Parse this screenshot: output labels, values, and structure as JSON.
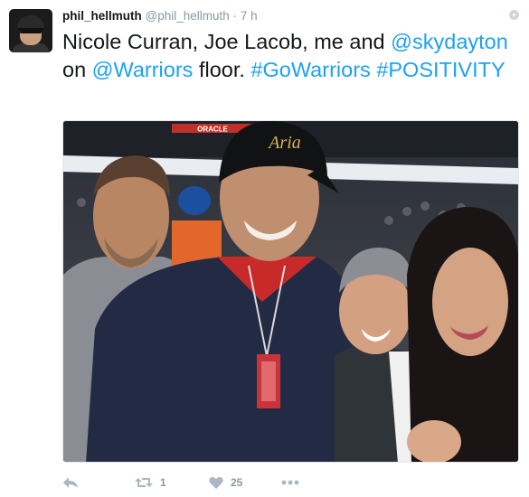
{
  "tweet": {
    "display_name": "phil_hellmuth",
    "handle": "@phil_hellmuth",
    "separator": "·",
    "time": "7 h",
    "text_parts": [
      {
        "text": "Nicole Curran, Joe Lacob, me and ",
        "link": false
      },
      {
        "text": "@skydayton",
        "link": true
      },
      {
        "text": " on ",
        "link": false
      },
      {
        "text": "@Warriors",
        "link": true
      },
      {
        "text": " floor. ",
        "link": false
      },
      {
        "text": "#GoWarriors",
        "link": true
      },
      {
        "text": " ",
        "link": false
      },
      {
        "text": "#POSITIVITY",
        "link": true
      }
    ],
    "photo": {
      "arena_banner": "ORACLE",
      "cap_text": "Aria"
    }
  },
  "actions": {
    "reply_icon": "reply-icon",
    "retweet_icon": "retweet-icon",
    "retweet_count": "1",
    "like_icon": "heart-icon",
    "like_count": "25",
    "more_icon": "more-dots-icon"
  },
  "colors": {
    "link": "#1da1f2",
    "muted": "#8899a6",
    "text": "#14171a"
  }
}
